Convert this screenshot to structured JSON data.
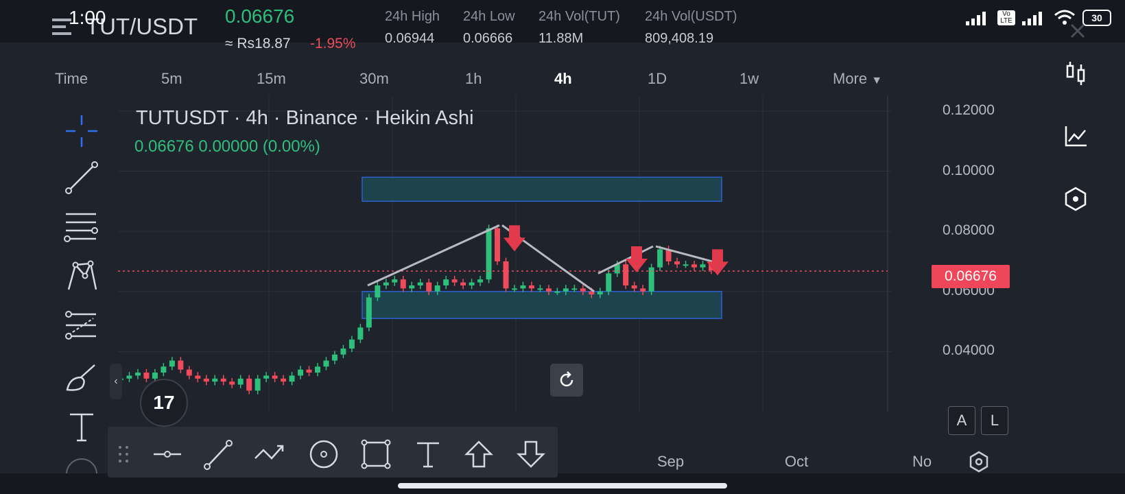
{
  "status": {
    "time": "1:00",
    "battery": "30",
    "network": "Vo LTE"
  },
  "header": {
    "pair": "TUT/USDT",
    "last_price": "0.06676",
    "fiat_price": "≈ Rs18.87",
    "change_pct": "-1.95%",
    "stats": [
      {
        "label": "24h High",
        "value": "0.06944"
      },
      {
        "label": "24h Low",
        "value": "0.06666"
      },
      {
        "label": "24h Vol(TUT)",
        "value": "11.88M"
      },
      {
        "label": "24h Vol(USDT)",
        "value": "809,408.19"
      }
    ]
  },
  "timeframes": {
    "items": [
      "Time",
      "5m",
      "15m",
      "30m",
      "1h",
      "4h",
      "1D",
      "1w",
      "More"
    ],
    "active": "4h"
  },
  "chart": {
    "title": "TUTUSDT · 4h · Binance · Heikin Ashi",
    "ohlc_line": "0.06676  0.00000 (0.00%)",
    "price_tag": "0.06676",
    "buttons": {
      "a": "A",
      "l": "L"
    },
    "tv_logo": "17"
  },
  "chart_data": {
    "type": "candlestick",
    "y_ticks": [
      "0.12000",
      "0.10000",
      "0.08000",
      "0.06000",
      "0.04000"
    ],
    "x_ticks": [
      "Sep",
      "Oct",
      "No"
    ],
    "ylim": [
      0.02,
      0.125
    ],
    "last_price": 0.06676,
    "zones": [
      {
        "from": 0.09,
        "to": 0.098
      },
      {
        "from": 0.051,
        "to": 0.06
      }
    ],
    "series_approx": [
      0.031,
      0.032,
      0.033,
      0.031,
      0.033,
      0.035,
      0.037,
      0.034,
      0.032,
      0.031,
      0.03,
      0.031,
      0.03,
      0.029,
      0.031,
      0.027,
      0.031,
      0.032,
      0.031,
      0.03,
      0.032,
      0.034,
      0.033,
      0.035,
      0.037,
      0.039,
      0.041,
      0.044,
      0.048,
      0.058,
      0.062,
      0.063,
      0.064,
      0.061,
      0.062,
      0.063,
      0.06,
      0.062,
      0.064,
      0.063,
      0.062,
      0.063,
      0.064,
      0.081,
      0.07,
      0.061,
      0.061,
      0.062,
      0.061,
      0.061,
      0.06,
      0.06,
      0.061,
      0.061,
      0.06,
      0.059,
      0.06,
      0.066,
      0.069,
      0.062,
      0.061,
      0.06,
      0.068,
      0.074,
      0.07,
      0.069,
      0.069,
      0.068,
      0.069,
      0.067
    ]
  },
  "drawbar": {
    "tools": [
      "horizontal-line",
      "trend-line",
      "path",
      "circle",
      "rectangle",
      "text",
      "arrow-up",
      "arrow-down"
    ]
  },
  "colors": {
    "up": "#2fbf7d",
    "down": "#ef4b5c",
    "zone_fill": "#1d4a52",
    "zone_border": "#2f5fd1",
    "bg": "#1f232c"
  }
}
